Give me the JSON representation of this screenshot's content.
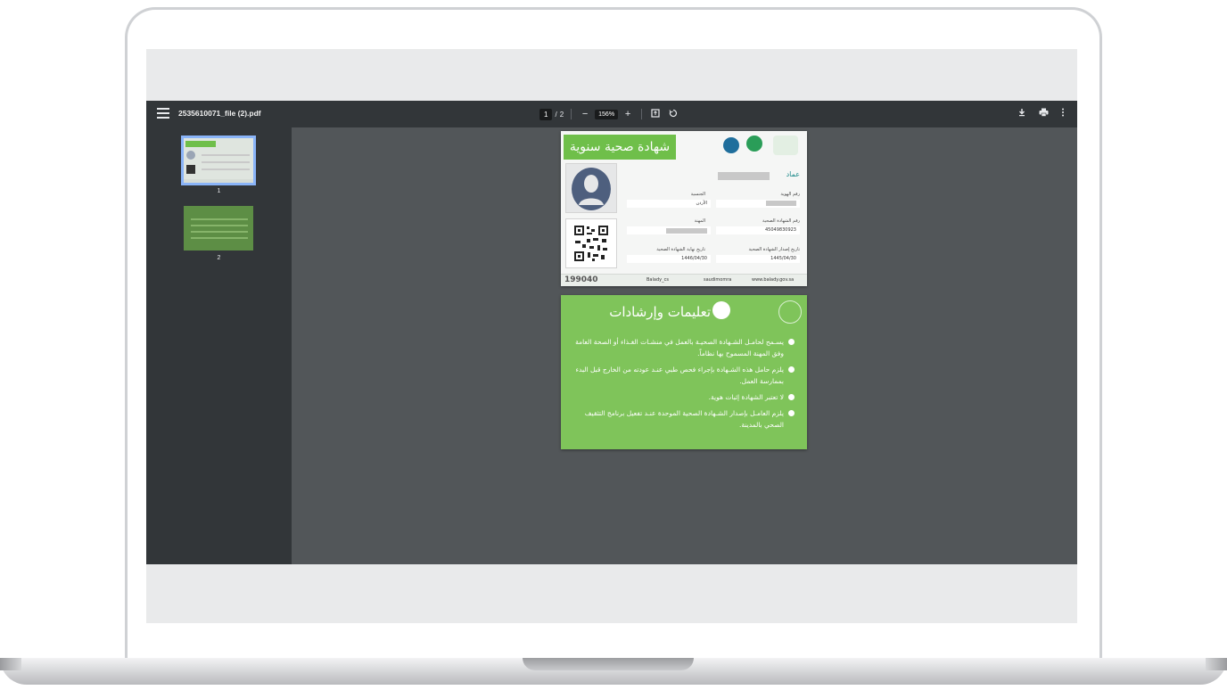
{
  "viewer": {
    "file_name": "2535610071_file (2).pdf",
    "current_page": "1",
    "page_sep": "/",
    "total_pages": "2",
    "zoom": "156%",
    "minus": "−",
    "plus": "+",
    "icons": [
      "menu-icon",
      "fit-page-icon",
      "rotate-icon",
      "download-icon",
      "print-icon",
      "more-icon"
    ]
  },
  "thumbnails": [
    {
      "label": "1"
    },
    {
      "label": "2"
    }
  ],
  "certificate": {
    "title": "شهادة صحية سنوية",
    "name_label": "عماد",
    "id_label": "رقم الهوية",
    "nationality_label": "الجنسية",
    "nationality_value": "الأردن",
    "cert_no_label": "رقم الشهادة الصحية",
    "cert_no_value": "45049830923",
    "job_label": "المهنة",
    "issue_label": "تاريخ إصدار الشهادة الصحية",
    "issue_value": "1445/04/30",
    "expiry_label": "تاريخ نهاية الشهادة الصحية",
    "expiry_value": "1446/04/30",
    "footer_phone": "199040",
    "footer_twitter": "Balady_cs",
    "footer_social": "saudimomra",
    "footer_web": "www.balady.gov.sa"
  },
  "instructions": {
    "title": "تعليمات وإرشادات",
    "items": [
      "يسـمح لحامـل الشـهادة الصحيـة بالعمل في منشـات الغـذاء أو الصحة العامة وفق المهنة المسموح بها نظاماً.",
      "يلزم حامل هذه الشـهادة بإجراء فحص طبي عنـد عودته من الخارج قبل البدء بممارسة العمل.",
      "لا تعتبر الشهادة إثبات هوية.",
      "يلزم العامـل بإصدار الشـهادة الصحية الموحدة عنـد تفعيل برنامج التثقيف الصحي بالمدينة."
    ]
  },
  "colors": {
    "toolbar": "#323639",
    "viewer_bg": "#525659",
    "cert_green": "#6fbf4a",
    "instructions_green": "#7fc45a"
  }
}
